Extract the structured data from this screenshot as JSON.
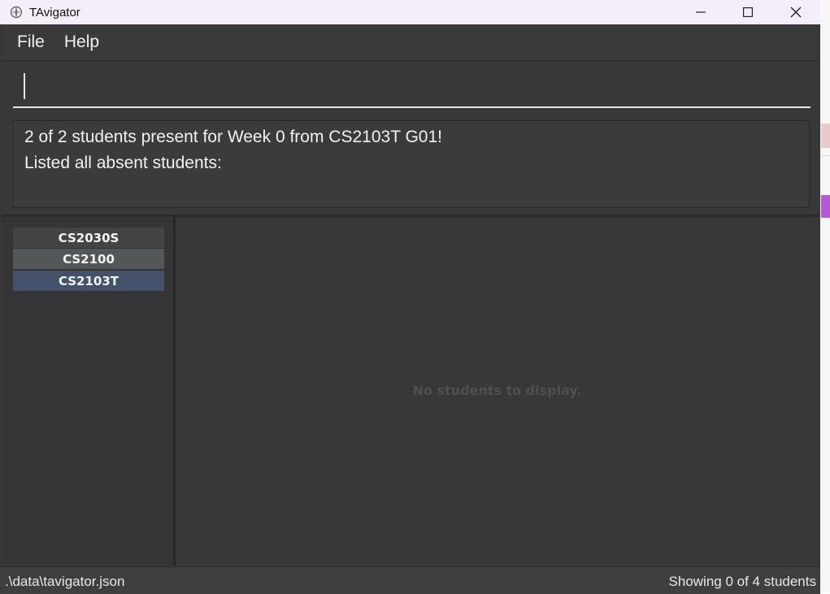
{
  "window": {
    "title": "TAvigator",
    "controls": {
      "minimize_icon": "minimize-icon",
      "maximize_icon": "maximize-icon",
      "close_icon": "close-icon"
    }
  },
  "menu": {
    "items": [
      {
        "label": "File"
      },
      {
        "label": "Help"
      }
    ]
  },
  "command": {
    "value": "",
    "placeholder": ""
  },
  "result": {
    "lines": [
      "2 of 2 students present for Week 0 from CS2103T G01!",
      "Listed all absent students:"
    ]
  },
  "modules": {
    "items": [
      {
        "code": "CS2030S",
        "state": "normal"
      },
      {
        "code": "CS2100",
        "state": "hover"
      },
      {
        "code": "CS2103T",
        "state": "selected"
      }
    ]
  },
  "students_panel": {
    "empty_message": "No students to display."
  },
  "status": {
    "file_path": ".\\data\\tavigator.json",
    "summary": "Showing 0 of 4 students"
  },
  "colors": {
    "background": "#383838",
    "titlebar": "#f3eef7",
    "module_normal": "#444444",
    "module_hover": "#525757",
    "module_selected": "#43516a",
    "text": "#f2f2f2",
    "muted_text": "#4f4f4f"
  }
}
